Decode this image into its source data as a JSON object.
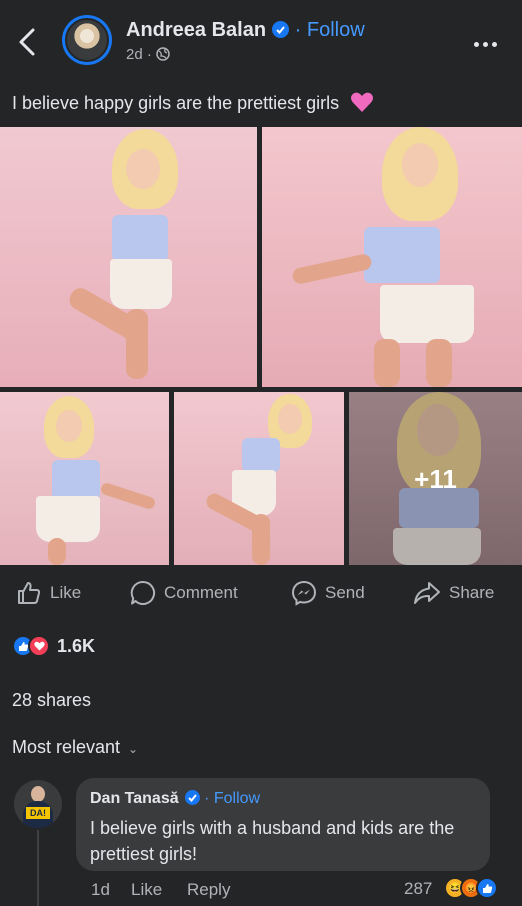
{
  "header": {
    "author_name": "Andreea Balan",
    "follow_label": "Follow",
    "separator": "·",
    "time": "2d",
    "audience_icon": "globe-icon",
    "back_icon": "chevron-left-icon",
    "more_icon": "more-horizontal-icon"
  },
  "post": {
    "caption": "I believe happy girls are the prettiest girls",
    "caption_emoji": "pink-heart-emoji",
    "more_photos_label": "+11"
  },
  "actions": {
    "like": "Like",
    "comment": "Comment",
    "send": "Send",
    "share": "Share"
  },
  "stats": {
    "reactions_count": "1.6K",
    "shares": "28 shares"
  },
  "comments": {
    "sort_label": "Most relevant",
    "items": [
      {
        "author": "Dan Tanasă",
        "follow_label": "Follow",
        "text": "I believe girls with a husband and kids are the prettiest girls!",
        "time": "1d",
        "like_label": "Like",
        "reply_label": "Reply",
        "reaction_count": "287",
        "avatar_badge": "DA!"
      }
    ]
  },
  "colors": {
    "background": "#242526",
    "accent": "#1877f2",
    "link": "#4599ff",
    "bubble": "#3a3b3c"
  }
}
